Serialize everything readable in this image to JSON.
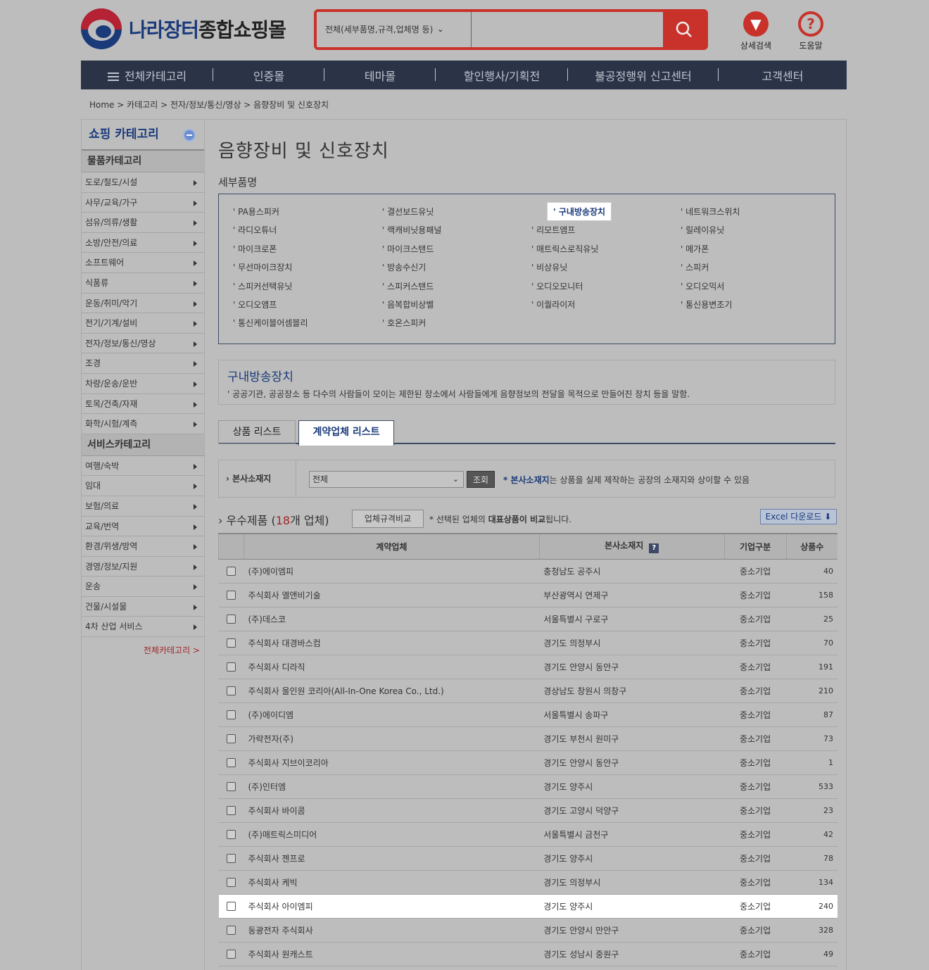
{
  "header": {
    "logo_text_a": "나라장터",
    "logo_text_b": "종합쇼핑몰",
    "search_scope": "전체(세부품명,규격,업체명 등)",
    "search_placeholder": "",
    "icons": [
      {
        "label": "상세검색",
        "icon": "filter-icon"
      },
      {
        "label": "도움말",
        "icon": "help-icon"
      }
    ]
  },
  "nav": [
    "전체카테고리",
    "인증몰",
    "테마몰",
    "할인행사/기획전",
    "불공정행위 신고센터",
    "고객센터"
  ],
  "breadcrumb": "Home > 카테고리 > 전자/정보/통신/영상 > 음향장비 및 신호장치",
  "sidebar": {
    "title": "쇼핑 카테고리",
    "goods_title": "물품카테고리",
    "goods": [
      "도로/철도/시설",
      "사무/교육/가구",
      "섬유/의류/생활",
      "소방/안전/의료",
      "소프트웨어",
      "식품류",
      "운동/취미/악기",
      "전기/기계/설비",
      "전자/정보/통신/영상",
      "조경",
      "차량/운송/운반",
      "토목/건축/자재",
      "화학/시험/계측"
    ],
    "service_title": "서비스카테고리",
    "services": [
      "여행/숙박",
      "임대",
      "보험/의료",
      "교육/번역",
      "환경/위생/방역",
      "경영/정보/지원",
      "운송",
      "건물/시설물",
      "4차 산업 서비스"
    ],
    "all_link": "전체카테고리 >"
  },
  "main": {
    "title": "음향장비 및 신호장치",
    "subcat_heading": "세부품명",
    "subcats": [
      [
        "PA용스피커",
        "결선보드유닛",
        "구내방송장치",
        "네트워크스위치"
      ],
      [
        "라디오튜너",
        "랙캐비닛용패널",
        "리모트앰프",
        "릴레이유닛"
      ],
      [
        "마이크로폰",
        "마이크스탠드",
        "매트릭스로직유닛",
        "메가폰"
      ],
      [
        "무선마이크장치",
        "방송수신기",
        "비상유닛",
        "스피커"
      ],
      [
        "스피커선택유닛",
        "스피커스탠드",
        "오디오모니터",
        "오디오믹서"
      ],
      [
        "오디오앰프",
        "음복합비상벨",
        "이퀄라이저",
        "통신용변조기"
      ],
      [
        "통신케이블어셈블리",
        "호온스피커",
        "",
        ""
      ]
    ],
    "selected_subcat": "구내방송장치",
    "desc_title": "구내방송장치",
    "desc_text": "공공기관, 공공장소 등 다수의 사람들이 모이는 제한된 장소에서 사람들에게 음향정보의 전달을 목적으로 만들어진 장치 등을 말함.",
    "tabs": [
      "상품 리스트",
      "계약업체 리스트"
    ],
    "active_tab": "계약업체 리스트",
    "filter": {
      "label": "본사소재지",
      "select_value": "전체",
      "button": "조회",
      "note_prefix": "* ",
      "note_bold": "본사소재지",
      "note_rest": "는 상품을 실제 제작하는 공장의 소재지와 상이할 수 있음"
    },
    "list": {
      "title_prefix": "우수제품 (",
      "count": "18",
      "title_suffix": "개 업체)",
      "compare_button": "업체규격비교",
      "note_a": "* 선택된 업체의 ",
      "note_bold": "대표상품이 비교",
      "note_b": "됩니다.",
      "excel_button": "Excel 다운로드"
    },
    "table": {
      "headers": [
        "계약업체",
        "본사소재지",
        "기업구분",
        "상품수"
      ],
      "rows": [
        [
          "(주)에이엠피",
          "충청남도 공주시",
          "중소기업",
          "40"
        ],
        [
          "주식회사 엘앤비기술",
          "부산광역시 연제구",
          "중소기업",
          "158"
        ],
        [
          "(주)데스코",
          "서울특별시 구로구",
          "중소기업",
          "25"
        ],
        [
          "주식회사 대경바스컴",
          "경기도 의정부시",
          "중소기업",
          "70"
        ],
        [
          "주식회사 디라직",
          "경기도 안양시 동안구",
          "중소기업",
          "191"
        ],
        [
          "주식회사 올인원 코리아(All-In-One Korea Co., Ltd.)",
          "경상남도 창원시 의창구",
          "중소기업",
          "210"
        ],
        [
          "(주)에이디엠",
          "서울특별시 송파구",
          "중소기업",
          "87"
        ],
        [
          "가락전자(주)",
          "경기도 부천시 원미구",
          "중소기업",
          "73"
        ],
        [
          "주식회사 지브이코리아",
          "경기도 안양시 동안구",
          "중소기업",
          "1"
        ],
        [
          "(주)인터엠",
          "경기도 양주시",
          "중소기업",
          "533"
        ],
        [
          "주식회사 바이콤",
          "경기도 고양시 덕양구",
          "중소기업",
          "23"
        ],
        [
          "(주)매트릭스미디어",
          "서울특별시 금천구",
          "중소기업",
          "42"
        ],
        [
          "주식회사 젠프로",
          "경기도 양주시",
          "중소기업",
          "78"
        ],
        [
          "주식회사 케빅",
          "경기도 의정부시",
          "중소기업",
          "134"
        ],
        [
          "주식회사 아이엠피",
          "경기도 양주시",
          "중소기업",
          "240"
        ],
        [
          "동광전자 주식회사",
          "경기도 안양시 만안구",
          "중소기업",
          "328"
        ],
        [
          "주식회사 원캐스트",
          "경기도 성남시 중원구",
          "중소기업",
          "49"
        ]
      ],
      "highlight_row": 14
    }
  }
}
